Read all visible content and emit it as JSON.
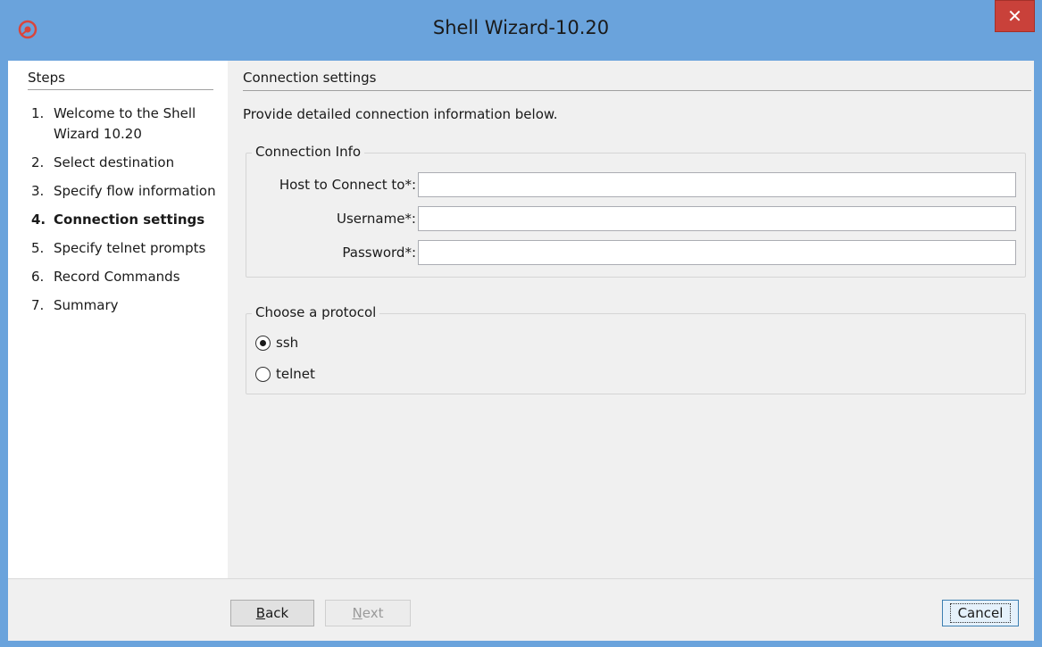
{
  "window": {
    "title": "Shell Wizard-10.20",
    "close_label": "✕"
  },
  "sidebar": {
    "header": "Steps",
    "steps": [
      {
        "num": "1.",
        "label": "Welcome to the Shell Wizard 10.20",
        "active": false
      },
      {
        "num": "2.",
        "label": "Select destination",
        "active": false
      },
      {
        "num": "3.",
        "label": "Specify flow information",
        "active": false
      },
      {
        "num": "4.",
        "label": "Connection settings",
        "active": true
      },
      {
        "num": "5.",
        "label": "Specify telnet prompts",
        "active": false
      },
      {
        "num": "6.",
        "label": "Record Commands",
        "active": false
      },
      {
        "num": "7.",
        "label": "Summary",
        "active": false
      }
    ]
  },
  "main": {
    "section_title": "Connection settings",
    "intro": "Provide detailed connection information below.",
    "connection_info": {
      "legend": "Connection Info",
      "host_label": "Host to Connect to*:",
      "host_value": "",
      "username_label": "Username*:",
      "username_value": "",
      "password_label": "Password*:",
      "password_value": ""
    },
    "protocol": {
      "legend": "Choose a protocol",
      "options": [
        {
          "label": "ssh",
          "checked": true
        },
        {
          "label": "telnet",
          "checked": false
        }
      ]
    }
  },
  "footer": {
    "back_label": "Back",
    "next_label": "Next",
    "cancel_label": "Cancel",
    "next_enabled": false
  },
  "colors": {
    "titlebar": "#6aa3dc",
    "close_button": "#c9413a",
    "app_icon": "#d9453b"
  },
  "icons": {
    "app": "app-logo-icon",
    "close": "close-icon"
  }
}
